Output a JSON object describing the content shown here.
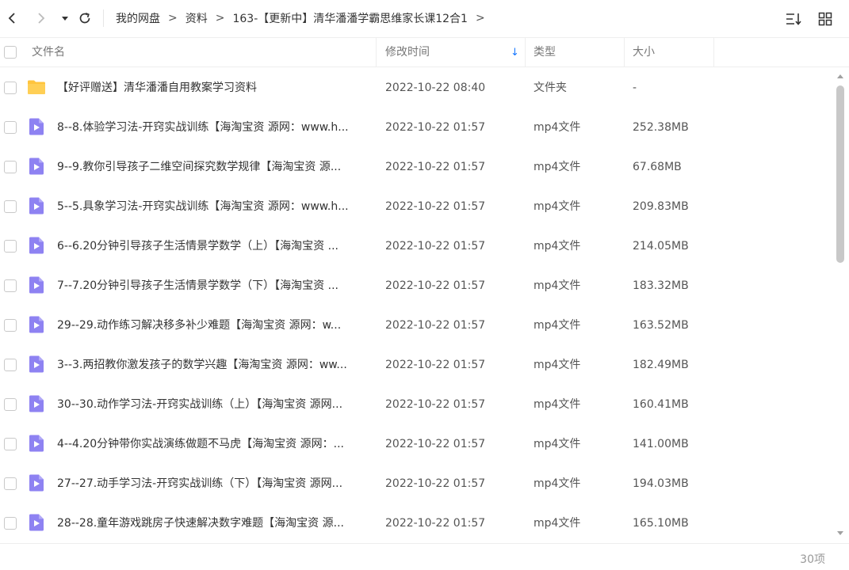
{
  "toolbar": {
    "back_icon": "chevron-left-icon",
    "forward_icon": "chevron-right-icon",
    "dropdown_icon": "caret-down-icon",
    "refresh_icon": "refresh-icon",
    "breadcrumb": [
      "我的网盘",
      "资料",
      "163-【更新中】清华潘潘学霸思维家长课12合1"
    ],
    "breadcrumb_sep": ">",
    "sort_icon": "sort-icon",
    "grid_icon": "grid-view-icon"
  },
  "header": {
    "name": "文件名",
    "modified": "修改时间",
    "type": "类型",
    "size": "大小",
    "sort_arrow": "↓"
  },
  "colors": {
    "accent": "#1677ff",
    "folder": "#ffc43d",
    "video": "#8e82f2"
  },
  "files": [
    {
      "icon": "folder-icon",
      "name": "【好评赠送】清华潘潘自用教案学习资料",
      "time": "2022-10-22 08:40",
      "type": "文件夹",
      "size": "-"
    },
    {
      "icon": "video-file-icon",
      "name": "8--8.体验学习法-开窍实战训练【海淘宝资 源网：www.h...",
      "time": "2022-10-22 01:57",
      "type": "mp4文件",
      "size": "252.38MB"
    },
    {
      "icon": "video-file-icon",
      "name": "9--9.教你引导孩子二维空间探究数学规律【海淘宝资 源...",
      "time": "2022-10-22 01:57",
      "type": "mp4文件",
      "size": "67.68MB"
    },
    {
      "icon": "video-file-icon",
      "name": "5--5.具象学习法-开窍实战训练【海淘宝资 源网：www.h...",
      "time": "2022-10-22 01:57",
      "type": "mp4文件",
      "size": "209.83MB"
    },
    {
      "icon": "video-file-icon",
      "name": "6--6.20分钟引导孩子生活情景学数学（上）【海淘宝资 ...",
      "time": "2022-10-22 01:57",
      "type": "mp4文件",
      "size": "214.05MB"
    },
    {
      "icon": "video-file-icon",
      "name": "7--7.20分钟引导孩子生活情景学数学（下）【海淘宝资 ...",
      "time": "2022-10-22 01:57",
      "type": "mp4文件",
      "size": "183.32MB"
    },
    {
      "icon": "video-file-icon",
      "name": "29--29.动作练习解决移多补少难题【海淘宝资 源网：w...",
      "time": "2022-10-22 01:57",
      "type": "mp4文件",
      "size": "163.52MB"
    },
    {
      "icon": "video-file-icon",
      "name": "3--3.两招教你激发孩子的数学兴趣【海淘宝资 源网：ww...",
      "time": "2022-10-22 01:57",
      "type": "mp4文件",
      "size": "182.49MB"
    },
    {
      "icon": "video-file-icon",
      "name": "30--30.动作学习法-开窍实战训练（上）【海淘宝资 源网...",
      "time": "2022-10-22 01:57",
      "type": "mp4文件",
      "size": "160.41MB"
    },
    {
      "icon": "video-file-icon",
      "name": "4--4.20分钟带你实战演练做题不马虎【海淘宝资 源网：...",
      "time": "2022-10-22 01:57",
      "type": "mp4文件",
      "size": "141.00MB"
    },
    {
      "icon": "video-file-icon",
      "name": "27--27.动手学习法-开窍实战训练（下）【海淘宝资 源网...",
      "time": "2022-10-22 01:57",
      "type": "mp4文件",
      "size": "194.03MB"
    },
    {
      "icon": "video-file-icon",
      "name": "28--28.童年游戏跳房子快速解决数字难题【海淘宝资 源...",
      "time": "2022-10-22 01:57",
      "type": "mp4文件",
      "size": "165.10MB"
    }
  ],
  "footer": {
    "count": "30项"
  }
}
